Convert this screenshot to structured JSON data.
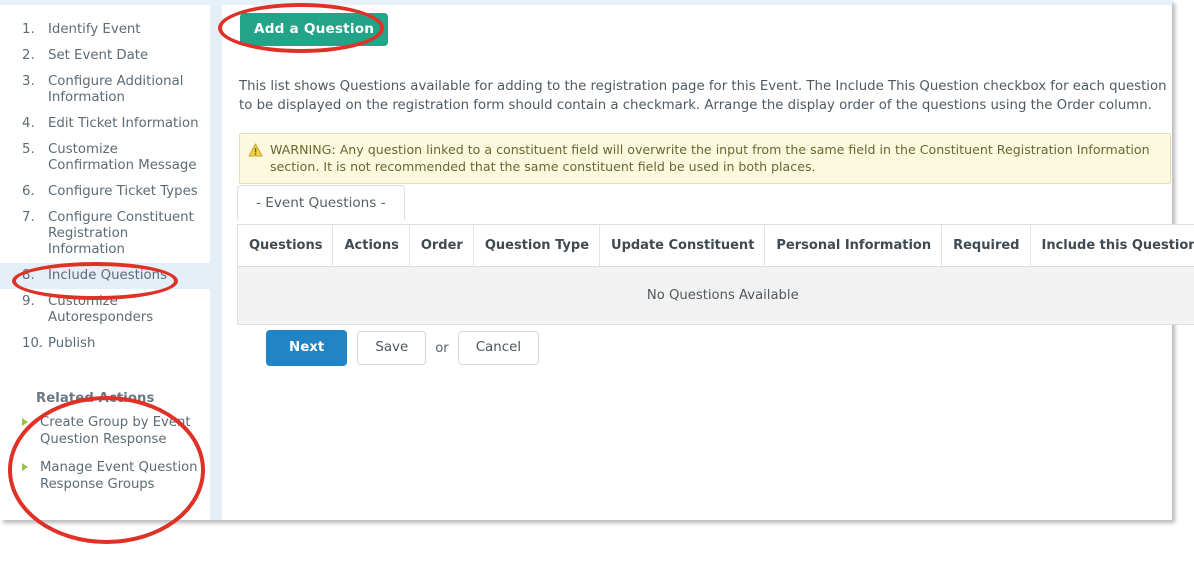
{
  "sidebar": {
    "steps": [
      {
        "num": "1.",
        "label": "Identify Event"
      },
      {
        "num": "2.",
        "label": "Set Event Date"
      },
      {
        "num": "3.",
        "label": "Configure Additional Information"
      },
      {
        "num": "4.",
        "label": "Edit Ticket Information"
      },
      {
        "num": "5.",
        "label": "Customize Confirmation Message"
      },
      {
        "num": "6.",
        "label": "Configure Ticket Types"
      },
      {
        "num": "7.",
        "label": "Configure Constituent Registration Information"
      },
      {
        "num": "8.",
        "label": "Include Questions"
      },
      {
        "num": "9.",
        "label": "Customize Autoresponders"
      },
      {
        "num": "10.",
        "label": "Publish"
      }
    ],
    "active_index": 7,
    "related": {
      "title": "Related Actions",
      "items": [
        "Create Group by Event Question Response",
        "Manage Event Question Response Groups"
      ]
    }
  },
  "main": {
    "add_question_label": "Add a Question",
    "description": "This list shows Questions available for adding to the registration page for this Event. The Include This Question checkbox for each question to be displayed on the registration form should contain a checkmark. Arrange the display order of the questions using the Order column.",
    "warning": {
      "icon": "warning-triangle-icon",
      "text": "WARNING: Any question linked to a constituent field will overwrite the input from the same field in the Constituent Registration Information section. It is not recommended that the same constituent field be used in both places."
    },
    "tab_label": "- Event Questions -",
    "table": {
      "columns": [
        "Questions",
        "Actions",
        "Order",
        "Question Type",
        "Update Constituent",
        "Personal Information",
        "Required",
        "Include this Question"
      ],
      "empty_message": "No Questions Available"
    },
    "buttons": {
      "next": "Next",
      "save": "Save",
      "or": "or",
      "cancel": "Cancel"
    }
  },
  "colors": {
    "add_button": "#23a387",
    "next_button": "#2283c5",
    "annotation": "#e03127",
    "active_step_bg": "#e4eff8",
    "warning_bg": "#fbfade",
    "bullet": "#9ac23b"
  }
}
